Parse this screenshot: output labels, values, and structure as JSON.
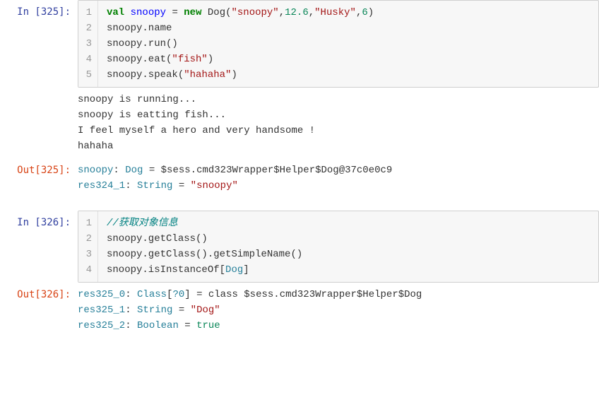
{
  "cells": [
    {
      "in_label": "In  [325]:",
      "code_lines": [
        {
          "n": "1",
          "html": "<span class='kw'>val</span> <span class='name-def'>snoopy</span> = <span class='blue-new'>new</span> Dog<span class='paren'>(</span><span class='str'>\"snoopy\"</span>,<span class='num'>12.6</span>,<span class='str'>\"Husky\"</span>,<span class='num'>6</span><span class='paren'>)</span>"
        },
        {
          "n": "2",
          "html": "snoopy.name"
        },
        {
          "n": "3",
          "html": "snoopy.run<span class='paren'>()</span>"
        },
        {
          "n": "4",
          "html": "snoopy.eat<span class='paren'>(</span><span class='str'>\"fish\"</span><span class='paren'>)</span>"
        },
        {
          "n": "5",
          "html": "snoopy.speak<span class='paren'>(</span><span class='str'>\"hahaha\"</span><span class='paren'>)</span>"
        }
      ],
      "stdout": "snoopy is running...\nsnoopy is eatting fish...\nI feel myself a hero and very handsome !\nhahaha",
      "out_label": "Out[325]:",
      "out_html": "<span class='res-name'>snoopy</span>: <span class='res-type'>Dog</span> = $sess.cmd323Wrapper$Helper$Dog@37c0e0c9\n<span class='res-name'>res324_1</span>: <span class='res-type'>String</span> = <span class='str'>\"snoopy\"</span>"
    },
    {
      "in_label": "In  [326]:",
      "code_lines": [
        {
          "n": "1",
          "html": "<span class='comment'>//获取对象信息</span>"
        },
        {
          "n": "2",
          "html": "snoopy.getClass<span class='paren'>()</span>"
        },
        {
          "n": "3",
          "html": "snoopy.getClass<span class='paren'>()</span>.getSimpleName<span class='paren'>()</span>"
        },
        {
          "n": "4",
          "html": "snoopy.isInstanceOf<span class='paren'>[</span><span class='res-type'>Dog</span><span class='paren'>]</span>"
        }
      ],
      "stdout": "",
      "out_label": "Out[326]:",
      "out_html": "<span class='res-name'>res325_0</span>: <span class='res-type'>Class</span>[<span class='res-type'>?0</span>] = class $sess.cmd323Wrapper$Helper$Dog\n<span class='res-name'>res325_1</span>: <span class='res-type'>String</span> = <span class='str'>\"Dog\"</span>\n<span class='res-name'>res325_2</span>: <span class='res-type'>Boolean</span> = <span class='num'>true</span>"
    }
  ]
}
